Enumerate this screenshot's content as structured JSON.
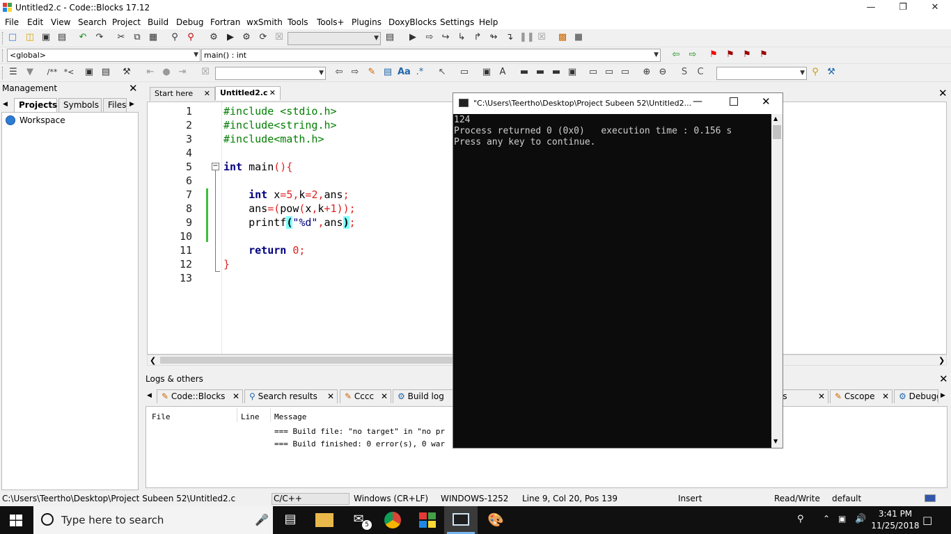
{
  "window": {
    "title": "Untitled2.c - Code::Blocks 17.12"
  },
  "menu": [
    "File",
    "Edit",
    "View",
    "Search",
    "Project",
    "Build",
    "Debug",
    "Fortran",
    "wxSmith",
    "Tools",
    "Tools+",
    "Plugins",
    "DoxyBlocks",
    "Settings",
    "Help"
  ],
  "scope": {
    "global": "<global>",
    "function": "main() : int"
  },
  "management": {
    "title": "Management",
    "tabs": [
      "Projects",
      "Symbols",
      "Files"
    ],
    "workspace": "Workspace"
  },
  "editor": {
    "tabs": [
      "Start here",
      "Untitled2.c"
    ],
    "line_numbers": [
      "1",
      "2",
      "3",
      "4",
      "5",
      "6",
      "7",
      "8",
      "9",
      "10",
      "11",
      "12",
      "13"
    ]
  },
  "console": {
    "title": "\"C:\\Users\\Teertho\\Desktop\\Project Subeen 52\\Untitled2...",
    "lines": [
      "124",
      "Process returned 0 (0x0)   execution time : 0.156 s",
      "Press any key to continue."
    ]
  },
  "logs": {
    "title": "Logs & others",
    "tabs": [
      "Code::Blocks",
      "Search results",
      "Cccc",
      "Build log",
      "es",
      "Cscope",
      "Debugge"
    ],
    "columns": [
      "File",
      "Line",
      "Message"
    ],
    "messages": [
      "=== Build file: \"no target\" in \"no pr",
      "=== Build finished: 0 error(s), 0 war"
    ]
  },
  "status": {
    "path": "C:\\Users\\Teertho\\Desktop\\Project Subeen 52\\Untitled2.c",
    "lang": "C/C++",
    "eol": "Windows (CR+LF)",
    "encoding": "WINDOWS-1252",
    "position": "Line 9, Col 20, Pos 139",
    "mode": "Insert",
    "access": "Read/Write",
    "profile": "default"
  },
  "taskbar": {
    "search_placeholder": "Type here to search",
    "time": "3:41 PM",
    "date": "11/25/2018",
    "mail_badge": "5"
  }
}
